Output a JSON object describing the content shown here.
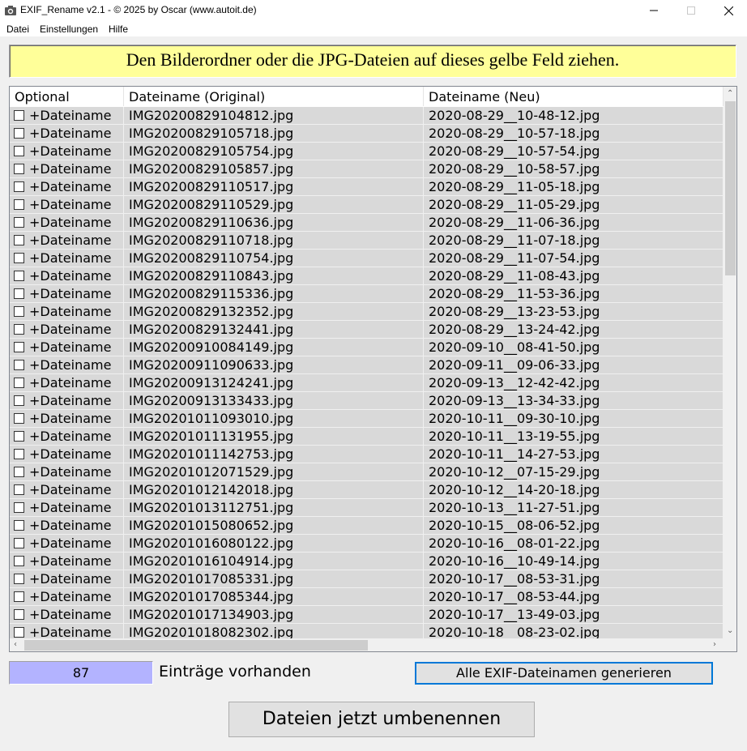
{
  "window": {
    "title": "EXIF_Rename v2.1 -  © 2025 by Oscar (www.autoit.de)",
    "icons": [
      "app-icon",
      "minimize-icon",
      "maximize-icon",
      "close-icon"
    ]
  },
  "menu": [
    "Datei",
    "Einstellungen",
    "Hilfe"
  ],
  "dropzone": {
    "text": "Den Bilderordner oder die JPG-Dateien auf dieses gelbe Feld ziehen.",
    "color": "#ffff99"
  },
  "list": {
    "columns": [
      "Optional",
      "Dateiname (Original)",
      "Dateiname (Neu)"
    ],
    "rows": [
      {
        "opt": "+Dateiname",
        "orig": "IMG20200829104812.jpg",
        "neu": "2020-08-29__10-48-12.jpg"
      },
      {
        "opt": "+Dateiname",
        "orig": "IMG20200829105718.jpg",
        "neu": "2020-08-29__10-57-18.jpg"
      },
      {
        "opt": "+Dateiname",
        "orig": "IMG20200829105754.jpg",
        "neu": "2020-08-29__10-57-54.jpg"
      },
      {
        "opt": "+Dateiname",
        "orig": "IMG20200829105857.jpg",
        "neu": "2020-08-29__10-58-57.jpg"
      },
      {
        "opt": "+Dateiname",
        "orig": "IMG20200829110517.jpg",
        "neu": "2020-08-29__11-05-18.jpg"
      },
      {
        "opt": "+Dateiname",
        "orig": "IMG20200829110529.jpg",
        "neu": "2020-08-29__11-05-29.jpg"
      },
      {
        "opt": "+Dateiname",
        "orig": "IMG20200829110636.jpg",
        "neu": "2020-08-29__11-06-36.jpg"
      },
      {
        "opt": "+Dateiname",
        "orig": "IMG20200829110718.jpg",
        "neu": "2020-08-29__11-07-18.jpg"
      },
      {
        "opt": "+Dateiname",
        "orig": "IMG20200829110754.jpg",
        "neu": "2020-08-29__11-07-54.jpg"
      },
      {
        "opt": "+Dateiname",
        "orig": "IMG20200829110843.jpg",
        "neu": "2020-08-29__11-08-43.jpg"
      },
      {
        "opt": "+Dateiname",
        "orig": "IMG20200829115336.jpg",
        "neu": "2020-08-29__11-53-36.jpg"
      },
      {
        "opt": "+Dateiname",
        "orig": "IMG20200829132352.jpg",
        "neu": "2020-08-29__13-23-53.jpg"
      },
      {
        "opt": "+Dateiname",
        "orig": "IMG20200829132441.jpg",
        "neu": "2020-08-29__13-24-42.jpg"
      },
      {
        "opt": "+Dateiname",
        "orig": "IMG20200910084149.jpg",
        "neu": "2020-09-10__08-41-50.jpg"
      },
      {
        "opt": "+Dateiname",
        "orig": "IMG20200911090633.jpg",
        "neu": "2020-09-11__09-06-33.jpg"
      },
      {
        "opt": "+Dateiname",
        "orig": "IMG20200913124241.jpg",
        "neu": "2020-09-13__12-42-42.jpg"
      },
      {
        "opt": "+Dateiname",
        "orig": "IMG20200913133433.jpg",
        "neu": "2020-09-13__13-34-33.jpg"
      },
      {
        "opt": "+Dateiname",
        "orig": "IMG20201011093010.jpg",
        "neu": "2020-10-11__09-30-10.jpg"
      },
      {
        "opt": "+Dateiname",
        "orig": "IMG20201011131955.jpg",
        "neu": "2020-10-11__13-19-55.jpg"
      },
      {
        "opt": "+Dateiname",
        "orig": "IMG20201011142753.jpg",
        "neu": "2020-10-11__14-27-53.jpg"
      },
      {
        "opt": "+Dateiname",
        "orig": "IMG20201012071529.jpg",
        "neu": "2020-10-12__07-15-29.jpg"
      },
      {
        "opt": "+Dateiname",
        "orig": "IMG20201012142018.jpg",
        "neu": "2020-10-12__14-20-18.jpg"
      },
      {
        "opt": "+Dateiname",
        "orig": "IMG20201013112751.jpg",
        "neu": "2020-10-13__11-27-51.jpg"
      },
      {
        "opt": "+Dateiname",
        "orig": "IMG20201015080652.jpg",
        "neu": "2020-10-15__08-06-52.jpg"
      },
      {
        "opt": "+Dateiname",
        "orig": "IMG20201016080122.jpg",
        "neu": "2020-10-16__08-01-22.jpg"
      },
      {
        "opt": "+Dateiname",
        "orig": "IMG20201016104914.jpg",
        "neu": "2020-10-16__10-49-14.jpg"
      },
      {
        "opt": "+Dateiname",
        "orig": "IMG20201017085331.jpg",
        "neu": "2020-10-17__08-53-31.jpg"
      },
      {
        "opt": "+Dateiname",
        "orig": "IMG20201017085344.jpg",
        "neu": "2020-10-17__08-53-44.jpg"
      },
      {
        "opt": "+Dateiname",
        "orig": "IMG20201017134903.jpg",
        "neu": "2020-10-17__13-49-03.jpg"
      },
      {
        "opt": "+Dateiname",
        "orig": "IMG20201018082302.jpg",
        "neu": "2020-10-18__08-23-02.jpg"
      }
    ]
  },
  "status": {
    "count": "87",
    "count_label": "Einträge vorhanden",
    "count_color": "#b3b3ff"
  },
  "buttons": {
    "generate": "Alle EXIF-Dateinamen generieren",
    "rename": "Dateien jetzt umbenennen"
  }
}
